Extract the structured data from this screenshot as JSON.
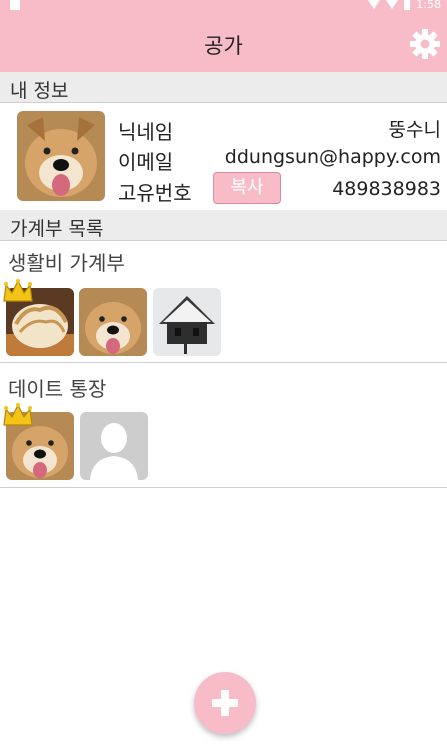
{
  "app": {
    "title": "공가"
  },
  "status_bar": {
    "time": "1:58"
  },
  "my_info": {
    "header": "내 정보",
    "nickname_label": "닉네임",
    "nickname": "뚱수니",
    "email_label": "이메일",
    "email": "ddungsun@happy.com",
    "id_label": "고유번호",
    "copy_label": "복사",
    "id_number": "489838983"
  },
  "ledger_list": {
    "header": "가계부 목록",
    "ledgers": [
      {
        "name": "생활비 가계부",
        "members": [
          "food-photo",
          "dog-photo",
          "house-photo"
        ],
        "owner_index": 0
      },
      {
        "name": "데이트 통장",
        "members": [
          "dog-photo",
          "default-user-silhouette"
        ],
        "owner_index": 0
      }
    ]
  },
  "colors": {
    "accent": "#f8bcc9",
    "accent_border": "#e08aa0",
    "header_bg": "#ececec"
  },
  "icons": {
    "settings": "gear-icon",
    "fab": "plus-icon",
    "owner": "crown-icon"
  }
}
